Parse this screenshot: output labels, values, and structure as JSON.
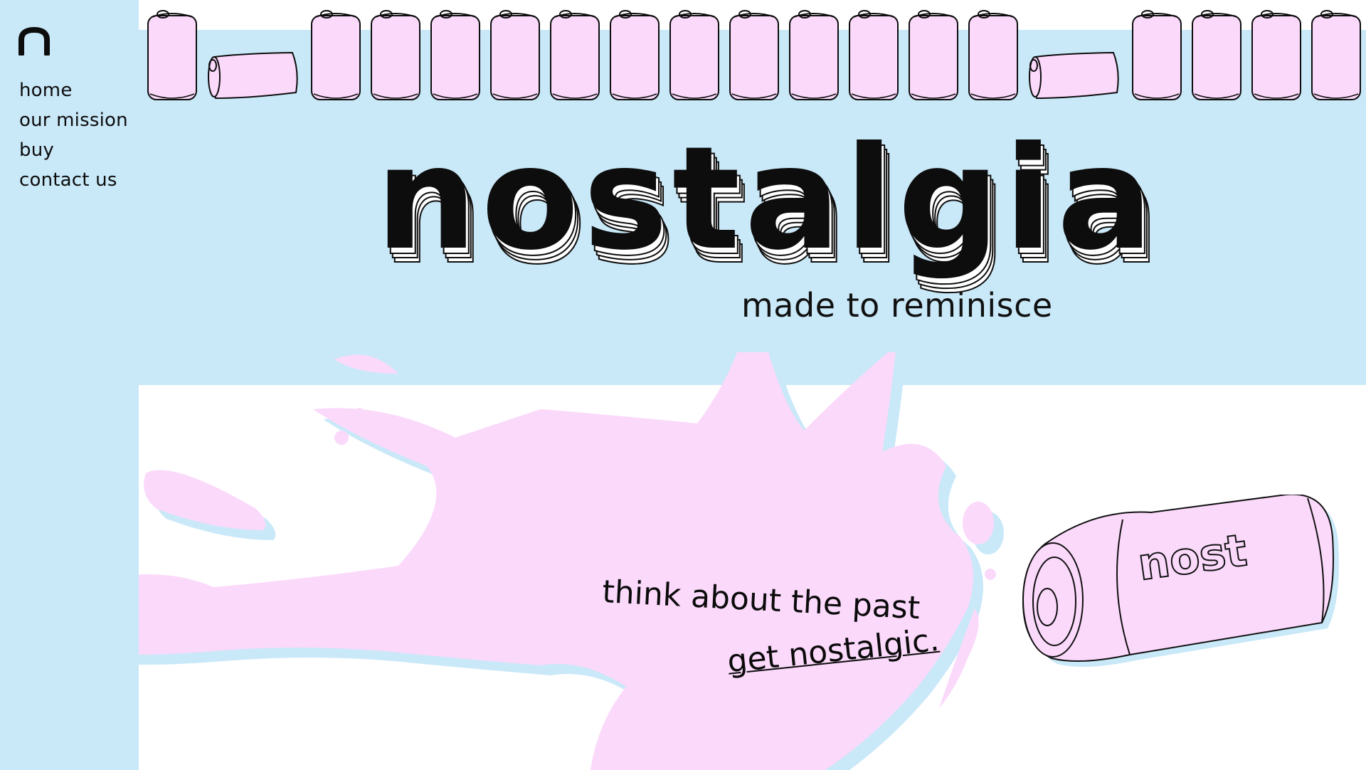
{
  "brand": {
    "logo_letter": "n",
    "title": "nostalgia",
    "tagline": "made to reminisce"
  },
  "nav": {
    "items": [
      {
        "label": "home"
      },
      {
        "label": "our mission"
      },
      {
        "label": "buy"
      },
      {
        "label": "contact us"
      }
    ]
  },
  "hero": {
    "slogan": "think about the past",
    "cta": "get nostalgic.",
    "can_label": "nost"
  },
  "colors": {
    "sky_blue": "#c9e8f8",
    "pink": "#fbd9fb",
    "ink": "#0d0d0d"
  },
  "can_strip": {
    "pattern": [
      "upright",
      "fallen",
      "upright",
      "upright",
      "upright",
      "upright",
      "upright",
      "upright",
      "upright",
      "upright",
      "upright",
      "upright",
      "upright",
      "upright",
      "fallen",
      "upright",
      "upright",
      "upright",
      "upright"
    ]
  }
}
